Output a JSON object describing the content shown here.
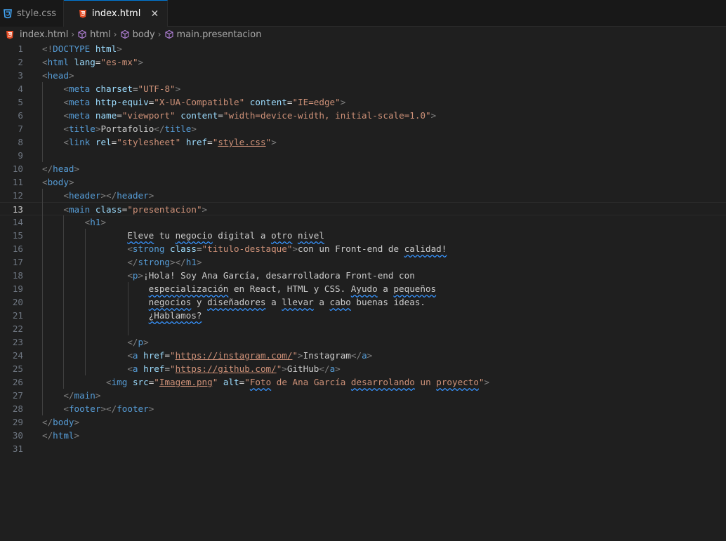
{
  "tabs": [
    {
      "label": "style.css",
      "icon": "css-file-icon",
      "active": false
    },
    {
      "label": "index.html",
      "icon": "html-file-icon",
      "active": true
    }
  ],
  "breadcrumb": [
    "index.html",
    "html",
    "body",
    "main.presentacion"
  ],
  "current_line": 13,
  "code_lines": [
    "<!DOCTYPE html>",
    "<html lang=\"es-mx\">",
    "<head>",
    "    <meta charset=\"UTF-8\">",
    "    <meta http-equiv=\"X-UA-Compatible\" content=\"IE=edge\">",
    "    <meta name=\"viewport\" content=\"width=device-width, initial-scale=1.0\">",
    "    <title>Portafolio</title>",
    "    <link rel=\"stylesheet\" href=\"style.css\">",
    "",
    "</head>",
    "<body>",
    "    <header></header>",
    "    <main class=\"presentacion\">",
    "        <h1>",
    "                Eleve tu negocio digital a otro nivel",
    "                <strong class=\"titulo-destaque\">con un Front-end de calidad!",
    "                </strong></h1>",
    "                <p>¡Hola! Soy Ana García, desarrolladora Front-end con",
    "                    especialización en React, HTML y CSS. Ayudo a pequeños",
    "                    negocios y diseñadores a llevar a cabo buenas ideas.",
    "                    ¿Hablamos?",
    "",
    "                </p>",
    "                <a href=\"https://instagram.com/\">Instagram</a>",
    "                <a href=\"https://github.com/\">GitHub</a>",
    "            <img src=\"Imagem.png\" alt=\"Foto de Ana García desarrolando un proyecto\">",
    "    </main>",
    "    <footer></footer>",
    "</body>",
    "</html>",
    ""
  ],
  "colors": {
    "tag": "#569cd6",
    "punctuation": "#808080",
    "attribute": "#9cdcfe",
    "string": "#ce9178",
    "text": "#cccccc",
    "spell_squiggle": "#3794ff",
    "active_tab_border": "#0078d4",
    "editor_bg": "#1f1f1f"
  }
}
